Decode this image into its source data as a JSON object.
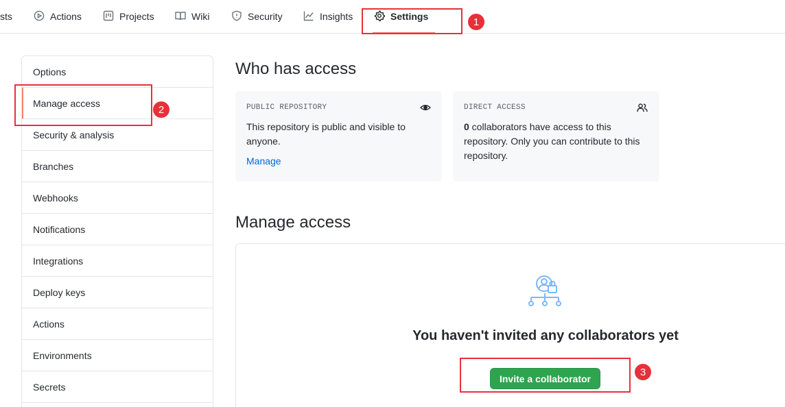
{
  "topnav": {
    "tabs": [
      {
        "label": "sts",
        "icon": "none"
      },
      {
        "label": "Actions",
        "icon": "play-icon"
      },
      {
        "label": "Projects",
        "icon": "project-board-icon"
      },
      {
        "label": "Wiki",
        "icon": "book-icon"
      },
      {
        "label": "Security",
        "icon": "shield-icon"
      },
      {
        "label": "Insights",
        "icon": "graph-icon"
      },
      {
        "label": "Settings",
        "icon": "gear-icon",
        "active": true
      }
    ]
  },
  "sidebar": {
    "items": [
      {
        "label": "Options"
      },
      {
        "label": "Manage access",
        "selected": true
      },
      {
        "label": "Security & analysis"
      },
      {
        "label": "Branches"
      },
      {
        "label": "Webhooks"
      },
      {
        "label": "Notifications"
      },
      {
        "label": "Integrations"
      },
      {
        "label": "Deploy keys"
      },
      {
        "label": "Actions"
      },
      {
        "label": "Environments"
      },
      {
        "label": "Secrets"
      }
    ]
  },
  "who_has_access": {
    "title": "Who has access",
    "public_card": {
      "label": "PUBLIC REPOSITORY",
      "icon": "eye-icon",
      "text": "This repository is public and visible to anyone.",
      "link": "Manage"
    },
    "direct_card": {
      "label": "DIRECT ACCESS",
      "icon": "people-icon",
      "count": "0",
      "text": " collaborators have access to this repository. Only you can contribute to this repository."
    }
  },
  "manage_access": {
    "title": "Manage access",
    "icon": "collaborators-lock-icon",
    "empty_title": "You haven't invited any collaborators yet",
    "invite_button": "Invite a collaborator"
  },
  "annotations": {
    "colors": {
      "highlight": "#e8303a"
    },
    "markers": [
      "1",
      "2",
      "3"
    ]
  },
  "colors": {
    "accent_underline": "#f9826c",
    "link": "#0366d6",
    "primary_button": "#2ea44f",
    "card_bg": "#f6f8fa"
  }
}
